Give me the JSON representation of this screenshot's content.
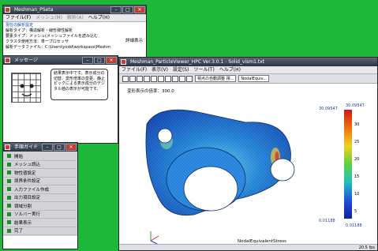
{
  "main_window": {
    "title": "Meshman_PSeta",
    "menu": [
      "ファイル(F)",
      "メッシュ(M)",
      "解析(A)",
      "ヘルプ(H)"
    ],
    "lines": [
      "現在の解析設定",
      "解析タイプ：構造解析・線形弾性解析",
      "要素タイプ：メッシュ(メッシュファイルを読み込む",
      "クラスタ使用方法：単一プロセッサ",
      "解析データファイル：C:\\Users\\yodd\\workspace\\Meshm"
    ],
    "detail_button": "詳細表示"
  },
  "message_window": {
    "title": "メッセージ",
    "text": "結果表示中です。表示成分の切替、変形倍率の変更、静止ピックによる表示成分のデジタル値の表示が可能です。"
  },
  "guide_window": {
    "title": "手順ガイド",
    "items": [
      "開始",
      "メッシュ読込",
      "物性値設定",
      "境界条件設定",
      "入力ファイル作成",
      "出力項目設定",
      "領域分割",
      "ソルバー実行",
      "結果表示",
      "完了"
    ]
  },
  "viewer_window": {
    "title": "Meshman_ParticleViewer_HPC Ver.3.0.1 - Solid_vism1.txt",
    "menu": [
      "ファイル(F)",
      "表示(V)",
      "設定(S)",
      "ツール(T)",
      "ヘルプ(H)"
    ],
    "dropdown1": "視点の自動調整 視...",
    "dropdown2": "NodalEquiv...",
    "deform_label": "変形表示の倍率：300.0",
    "legend_title": "30.09547",
    "legend_max_label": "30.09547",
    "legend_min_label": "0.01188",
    "legend_min_bottom": "0.01188",
    "legend_ticks": [
      "30",
      "25",
      "20",
      "15",
      "10",
      "5"
    ],
    "axis_caption": "NodalEquivalentStress",
    "status": "20.5 fps"
  },
  "colors": {
    "desktop": "#1db83a",
    "titlebar": "#2c3440",
    "accent_blue": "#004bd0",
    "guide_marker": "#1a8f2a"
  }
}
